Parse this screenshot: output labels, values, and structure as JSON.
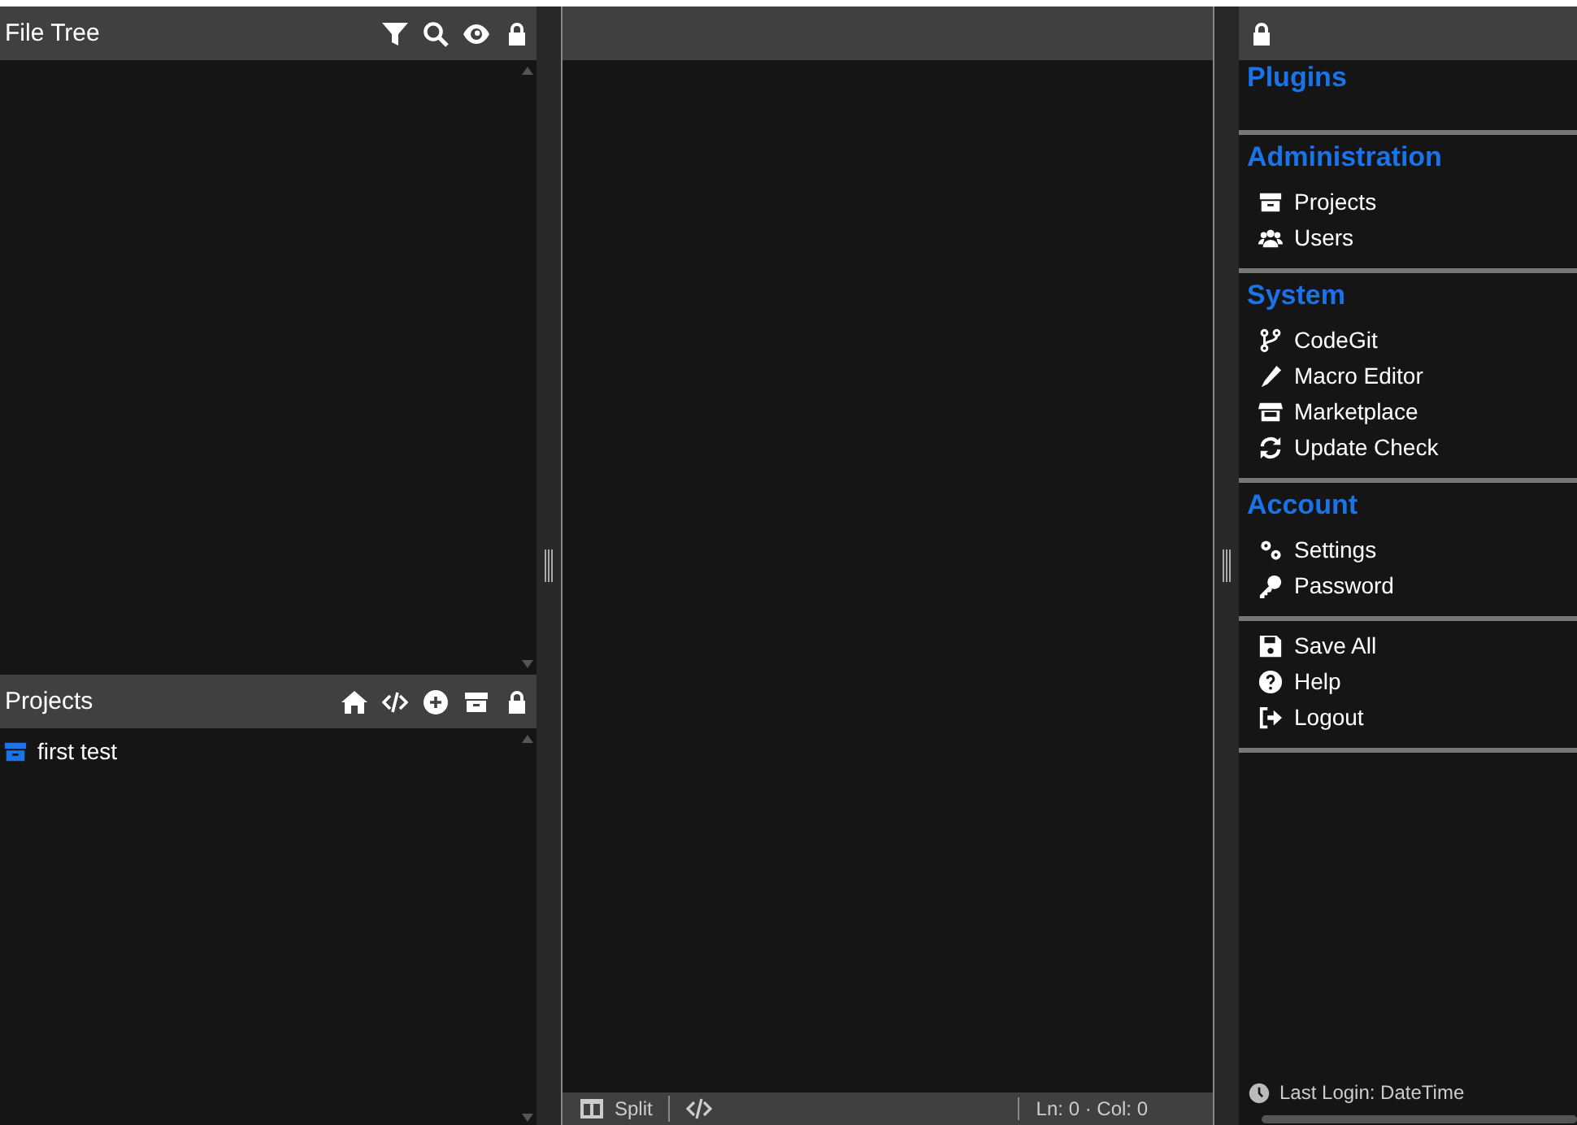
{
  "file_tree": {
    "title": "File Tree"
  },
  "projects_panel": {
    "title": "Projects",
    "items": [
      {
        "label": "first test"
      }
    ]
  },
  "editor": {
    "status_bar": {
      "split": "Split",
      "position": "Ln: 0 · Col: 0"
    }
  },
  "menu": {
    "sections": [
      {
        "title": "Plugins"
      },
      {
        "title": "Administration",
        "items": [
          {
            "label": "Projects"
          },
          {
            "label": "Users"
          }
        ]
      },
      {
        "title": "System",
        "items": [
          {
            "label": "CodeGit"
          },
          {
            "label": "Macro Editor"
          },
          {
            "label": "Marketplace"
          },
          {
            "label": "Update Check"
          }
        ]
      },
      {
        "title": "Account",
        "items": [
          {
            "label": "Settings"
          },
          {
            "label": "Password"
          }
        ]
      },
      {
        "items": [
          {
            "label": "Save All"
          },
          {
            "label": "Help"
          },
          {
            "label": "Logout"
          }
        ]
      }
    ],
    "last_login": "Last Login: DateTime"
  }
}
